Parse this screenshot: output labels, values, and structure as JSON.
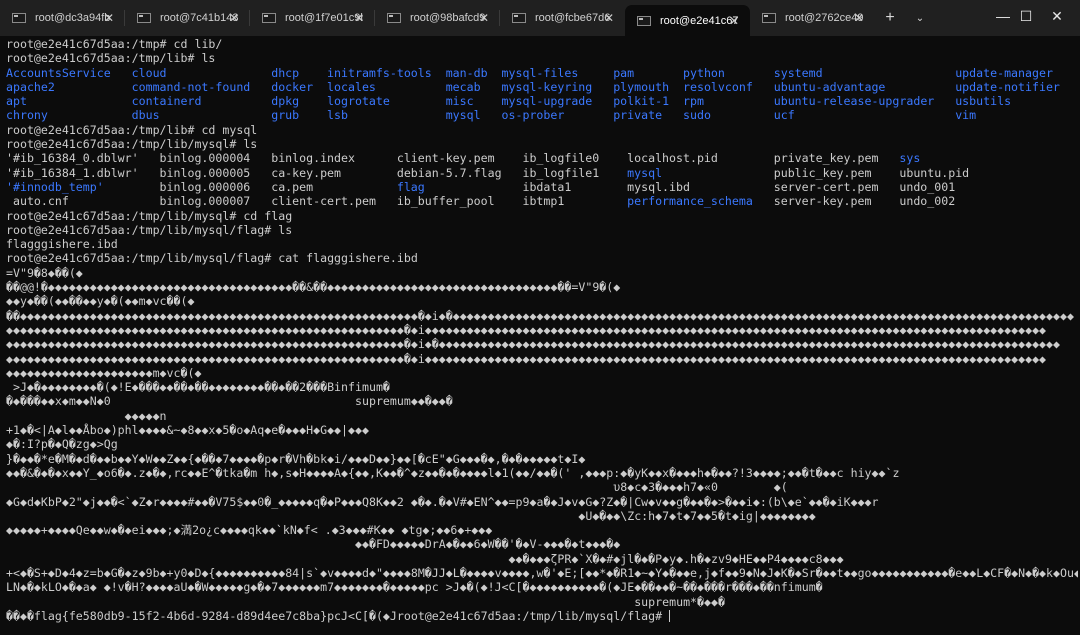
{
  "tabs": [
    {
      "label": "root@dc3a94fb",
      "active": false
    },
    {
      "label": "root@7c41b143",
      "active": false
    },
    {
      "label": "root@1f7e01c9b",
      "active": false
    },
    {
      "label": "root@98bafcd9",
      "active": false
    },
    {
      "label": "root@fcbe67d6",
      "active": false
    },
    {
      "label": "root@e2e41c67",
      "active": true
    },
    {
      "label": "root@2762ce49",
      "active": false
    }
  ],
  "tab_close_glyph": "✕",
  "new_tab_glyph": "+",
  "dropdown_glyph": "⌄",
  "window_controls": {
    "minimize": "—",
    "maximize": "☐",
    "close": "✕"
  },
  "colors": {
    "directory": "#3b78ff",
    "text": "#cccccc",
    "background": "#0c0c0c"
  },
  "terminal": {
    "cmd1": "root@e2e41c67d5aa:/tmp# cd lib/",
    "cmd2": "root@e2e41c67d5aa:/tmp/lib# ls",
    "lib_listing": [
      [
        "AccountsService",
        "cloud",
        "dhcp",
        "initramfs-tools",
        "man-db",
        "mysql-files",
        "pam",
        "python",
        "systemd",
        "update-manager"
      ],
      [
        "apache2",
        "command-not-found",
        "docker",
        "locales",
        "mecab",
        "mysql-keyring",
        "plymouth",
        "resolvconf",
        "ubuntu-advantage",
        "update-notifier"
      ],
      [
        "apt",
        "containerd",
        "dpkg",
        "logrotate",
        "misc",
        "mysql-upgrade",
        "polkit-1",
        "rpm",
        "ubuntu-release-upgrader",
        "usbutils"
      ],
      [
        "chrony",
        "dbus",
        "grub",
        "lsb",
        "mysql",
        "os-prober",
        "private",
        "sudo",
        "ucf",
        "vim"
      ]
    ],
    "cmd3": "root@e2e41c67d5aa:/tmp/lib# cd mysql",
    "cmd4": "root@e2e41c67d5aa:/tmp/lib/mysql# ls",
    "mysql_listing": [
      [
        {
          "t": "'#ib_16384_0.dblwr'",
          "d": false
        },
        {
          "t": "binlog.000004",
          "d": false
        },
        {
          "t": "binlog.index",
          "d": false
        },
        {
          "t": "client-key.pem",
          "d": false
        },
        {
          "t": "ib_logfile0",
          "d": false
        },
        {
          "t": "localhost.pid",
          "d": false
        },
        {
          "t": "private_key.pem",
          "d": false
        },
        {
          "t": "sys",
          "d": true
        }
      ],
      [
        {
          "t": "'#ib_16384_1.dblwr'",
          "d": false
        },
        {
          "t": "binlog.000005",
          "d": false
        },
        {
          "t": "ca-key.pem",
          "d": false
        },
        {
          "t": "debian-5.7.flag",
          "d": false
        },
        {
          "t": "ib_logfile1",
          "d": false
        },
        {
          "t": "mysql",
          "d": true
        },
        {
          "t": "public_key.pem",
          "d": false
        },
        {
          "t": "ubuntu.pid",
          "d": false
        }
      ],
      [
        {
          "t": "'#innodb_temp'",
          "d": true
        },
        {
          "t": "binlog.000006",
          "d": false
        },
        {
          "t": "ca.pem",
          "d": false
        },
        {
          "t": "flag",
          "d": true
        },
        {
          "t": "ibdata1",
          "d": false
        },
        {
          "t": "mysql.ibd",
          "d": false
        },
        {
          "t": "server-cert.pem",
          "d": false
        },
        {
          "t": "undo_001",
          "d": false
        }
      ],
      [
        {
          "t": " auto.cnf",
          "d": false
        },
        {
          "t": "binlog.000007",
          "d": false
        },
        {
          "t": "client-cert.pem",
          "d": false
        },
        {
          "t": "ib_buffer_pool",
          "d": false
        },
        {
          "t": "ibtmp1",
          "d": false
        },
        {
          "t": "performance_schema",
          "d": true
        },
        {
          "t": "server-key.pem",
          "d": false
        },
        {
          "t": "undo_002",
          "d": false
        }
      ]
    ],
    "cmd5": "root@e2e41c67d5aa:/tmp/lib/mysql# cd flag",
    "cmd6": "root@e2e41c67d5aa:/tmp/lib/mysql/flag# ls",
    "flag_listing": "flagggishere.ibd",
    "cmd7": "root@e2e41c67d5aa:/tmp/lib/mysql/flag# cat flagggishere.ibd",
    "binary_lines": [
      "=V\"9�8◆��(◆",
      "��@@!�◆◆◆◆◆◆◆◆◆◆◆◆◆◆◆◆◆◆◆◆◆◆◆◆◆◆◆◆◆◆◆◆◆◆◆��&��◆◆◆◆◆◆◆◆◆◆◆◆◆◆◆◆◆◆◆◆◆◆◆◆◆◆◆◆◆◆◆◆◆��=V\"9�(◆",
      "◆◆y◆��(◆◆��◆◆y◆�(◆◆m◆vc��(◆",
      "��◆◆◆◆◆◆◆◆◆◆◆◆◆◆◆◆◆◆◆◆◆◆◆◆◆◆◆◆◆◆◆◆◆◆◆◆◆◆◆◆◆◆◆◆◆◆◆◆◆◆◆◆◆◆◆◆◆�◆i◆�◆◆◆◆◆◆◆◆◆◆◆◆◆◆◆◆◆◆◆◆◆◆◆◆◆◆◆◆◆◆◆◆◆◆◆◆◆◆◆◆◆◆◆◆◆◆◆◆◆◆◆◆◆◆◆◆◆◆◆◆◆◆◆◆◆◆◆◆◆◆◆◆◆◆◆◆◆◆◆◆◆◆◆◆◆◆◆◆◆",
      "◆◆◆◆◆◆◆◆◆◆◆◆◆◆◆◆◆◆◆◆◆◆◆◆◆◆◆◆◆◆◆◆◆◆◆◆◆◆◆◆◆◆◆◆◆◆◆◆◆◆◆◆◆◆◆◆◆�◆i◆◆◆◆◆◆◆◆◆◆◆◆◆◆◆◆◆◆◆◆◆◆◆◆◆◆◆◆◆◆◆◆◆◆◆◆◆◆◆◆◆◆◆◆◆◆◆◆◆◆◆◆◆◆◆◆◆◆◆◆◆◆◆◆◆◆◆◆◆◆◆◆◆◆◆◆◆◆◆◆◆◆◆◆◆◆◆◆◆",
      "◆◆◆◆◆◆◆◆◆◆◆◆◆◆◆◆◆◆◆◆◆◆◆◆◆◆◆◆◆◆◆◆◆◆◆◆◆◆◆◆◆◆◆◆◆◆◆◆◆◆◆◆◆◆◆◆◆�◆i◆�◆◆◆◆◆◆◆◆◆◆◆◆◆◆◆◆◆◆◆◆◆◆◆◆◆◆◆◆◆◆◆◆◆◆◆◆◆◆◆◆◆◆◆◆◆◆◆◆◆◆◆◆◆◆◆◆◆◆◆◆◆◆◆◆◆◆◆◆◆◆◆◆◆◆◆◆◆◆◆◆◆◆◆◆◆◆◆◆◆",
      "◆◆◆◆◆◆◆◆◆◆◆◆◆◆◆◆◆◆◆◆◆◆◆◆◆◆◆◆◆◆◆◆◆◆◆◆◆◆◆◆◆◆◆◆◆◆◆◆◆◆◆◆◆◆◆◆◆�◆i◆◆◆◆◆◆◆◆◆◆◆◆◆◆◆◆◆◆◆◆◆◆◆◆◆◆◆◆◆◆◆◆◆◆◆◆◆◆◆◆◆◆◆◆◆◆◆◆◆◆◆◆◆◆◆◆◆◆◆◆◆◆◆◆◆◆◆◆◆◆◆◆◆◆◆◆◆◆◆◆◆◆◆◆◆◆◆◆◆",
      "◆◆◆◆◆◆◆◆◆◆◆◆◆◆◆◆◆◆◆◆◆m◆vc�(◆",
      " >J◆�◆◆◆◆◆◆◆◆�(◆!E◆���◆◆��◆��◆◆◆◆◆◆◆◆��◆��2���Binfimum�",
      "�◆���◆◆x◆m◆◆N◆0                                   supremum◆◆�◆◆�",
      "                 ◆◆◆◆◆n",
      "+1◆�<|A◆l◆◆Åbo◆)phl◆◆◆◆&~◆8◆◆x◆5�o◆Aq◆e�◆◆◆H◆G◆◆|◆◆◆",
      "◆�:I?p�◆Q�zg◆>Qg",
      "}�◆◆�*e�M�◆d�◆◆b◆◆Y◆W◆◆Z◆◆{◆��◆7◆◆◆◆�p◆r�Vh�bk◆i/◆◆◆D◆◆}◆◆[�cE\"◆G◆◆◆�◆,�◆�◆◆◆◆◆t◆I◆",
      "◆◆�&�◆�◆x◆◆Y_◆o6�◆.z◆�◆,rc◆◆E^�tka�m h◆,s◆H◆◆◆◆A◆{◆◆,K◆◆�^◆z◆◆�◆�◆◆◆◆l◆1(◆◆/◆◆�(' ,◆◆◆p:◆�yK◆◆x�◆◆◆h◆�◆◆?!3◆◆◆◆;◆◆�t�◆◆c hiy◆◆`z",
      "                                                                                       υ8◆c◆3�◆◆◆h7◆«0        ◆(",
      "◆G◆d◆KbP◆2\"◆j◆◆�<`◆Z◆r◆◆◆◆#◆◆�V75$◆◆0�_◆◆◆◆◆q�◆P◆◆◆Q8K◆◆2 ◆�◆.�◆V#◆EN^◆◆=p9◆a�◆J◆v◆G◆?Z◆�|Cw◆v◆◆g�◆◆�◆>�◆◆i◆:(b\\◆e`◆◆�◆iK◆◆◆r",
      "                                                                                  ◆U◆�◆◆\\Zc:h◆7◆t◆7◆◆5�t◆ig|◆◆◆◆◆◆◆◆",
      "◆◆◆◆◆+◆◆◆◆Qe◆◆w◆�◆ei◆◆◆;◆満2o¿c◆◆◆◆qk◆◆`kN◆f< .◆3◆◆◆#K◆◆ ◆tg◆;◆◆6◆+◆◆◆",
      "                                                  ◆◆�FD◆◆◆◆◆DrA◆�◆◆6◆W��'�◆V-◆◆◆�◆t◆◆◆�◆",
      "                                                                        ◆◆�◆◆◆ζPR◆`X�◆#◆jl�◆�P◆y◆.h�◆zv9◆HE◆◆P4◆◆◆◆c8◆◆◆",
      "+<◆�S+◆D◆4◆z=b◆G�◆z◆9b◆+y0◆D◆{◆◆◆◆◆◆◆◆◆◆84|s`◆v◆◆◆◆d◆\"◆◆◆◆8M�JJ◆L�◆◆◆◆v◆◆◆◆,w�'◆E;[◆◆*◆�R1◆~◆Y◆�◆◆e,j◆f◆◆9◆N◆J◆K�◆Sr�◆◆t◆◆go◆◆◆◆◆◆◆◆◆◆◆�e◆◆L◆CF�◆N◆�◆k◆Ou◆k",
      "LN◆�◆kLO◆�◆a◆ ◆!v�H?◆◆◆◆aU◆�W◆◆◆◆◆g◆�◆7◆◆◆◆◆◆m7◆◆◆◆◆◆◆�◆◆◆◆◆pc >J◆�(◆!J<C[�◆◆◆◆◆◆◆◆◆◆�(◆JE◆��◆◆�~��◆���r���◆��nfimum�",
      "                                                                                          supremum*�◆◆�"
    ],
    "flag_line": "��◆�flag{fe580db9-15f2-4b6d-9284-d89d4ee7c8ba}pcJ<C[�(◆Jroot@e2e41c67d5aa:/tmp/lib/mysql/flag# "
  }
}
